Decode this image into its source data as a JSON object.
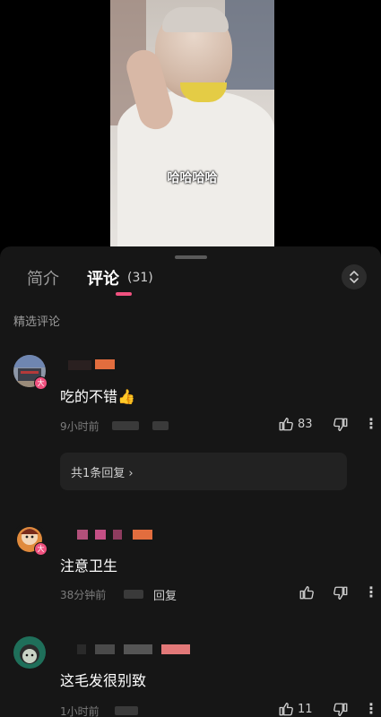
{
  "video": {
    "caption": "哈哈哈哈"
  },
  "panel": {
    "tabs": [
      {
        "label": "简介"
      },
      {
        "label": "评论"
      }
    ],
    "comment_count": "(31)",
    "section_label": "精选评论"
  },
  "comments": [
    {
      "text": "吃的不错",
      "emoji": "👍",
      "time": "9小时前",
      "likes": "83",
      "replies_label": "共1条回复",
      "avatar_badge": "大"
    },
    {
      "text": "注意卫生",
      "time": "38分钟前",
      "reply_label": "回复",
      "avatar_badge": "大"
    },
    {
      "text": "这毛发很别致",
      "time": "1小时前",
      "likes": "11"
    }
  ],
  "colors": {
    "accent": "#f0517f",
    "panel_bg": "#161616",
    "reply_box_bg": "#222222"
  }
}
